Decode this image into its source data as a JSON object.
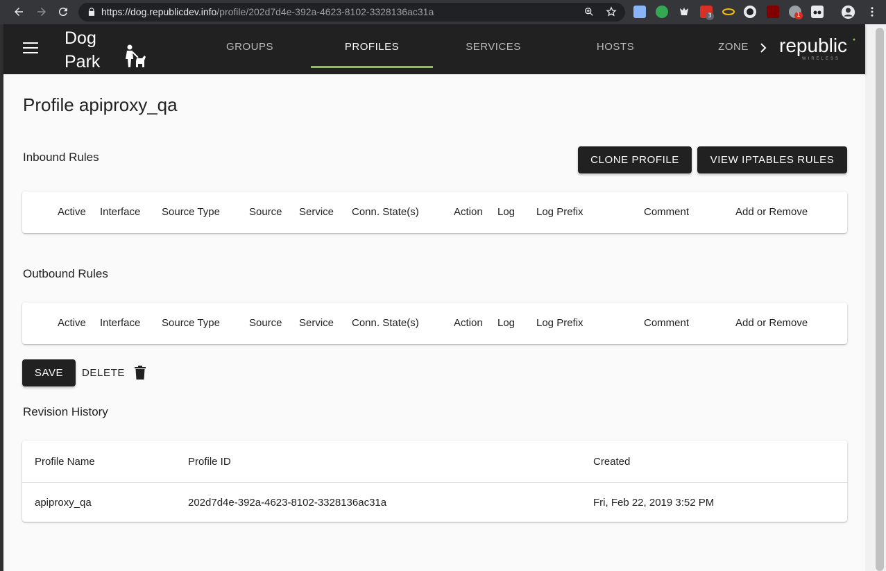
{
  "browser": {
    "url_host": "https://dog.republicdev.info",
    "url_path": "/profile/202d7d4e-392a-4623-8102-3328136ac31a",
    "extensions": [
      {
        "name": "extension-1",
        "badge": ""
      },
      {
        "name": "extension-2",
        "badge": ""
      },
      {
        "name": "extension-3",
        "badge": ""
      },
      {
        "name": "extension-4",
        "badge": "3"
      },
      {
        "name": "extension-5",
        "badge": ""
      },
      {
        "name": "extension-6",
        "badge": ""
      },
      {
        "name": "ublock",
        "badge": ""
      },
      {
        "name": "extension-8",
        "badge": "1"
      },
      {
        "name": "extension-9",
        "badge": ""
      }
    ]
  },
  "app": {
    "brand_line1": "Dog",
    "brand_line2": "Park",
    "tabs": [
      "GROUPS",
      "PROFILES",
      "SERVICES",
      "HOSTS",
      "ZONE"
    ],
    "active_tab": "PROFILES",
    "logo_text": "republic",
    "logo_subtext": "WIRELESS",
    "accent_color": "#8bc34a"
  },
  "page": {
    "title": "Profile apiproxy_qa",
    "clone_button": "CLONE PROFILE",
    "iptables_button": "VIEW IPTABLES RULES",
    "inbound_title": "Inbound Rules",
    "outbound_title": "Outbound Rules",
    "rule_columns": [
      "Active",
      "Interface",
      "Source Type",
      "Source",
      "Service",
      "Conn. State(s)",
      "Action",
      "Log",
      "Log Prefix",
      "Comment",
      "Add or Remove"
    ],
    "save_button": "SAVE",
    "delete_button": "DELETE",
    "revision_title": "Revision History",
    "revision_columns": [
      "Profile Name",
      "Profile ID",
      "Created"
    ],
    "revisions": [
      {
        "name": "apiproxy_qa",
        "id": "202d7d4e-392a-4623-8102-3328136ac31a",
        "created": "Fri, Feb 22, 2019 3:52 PM"
      }
    ]
  }
}
